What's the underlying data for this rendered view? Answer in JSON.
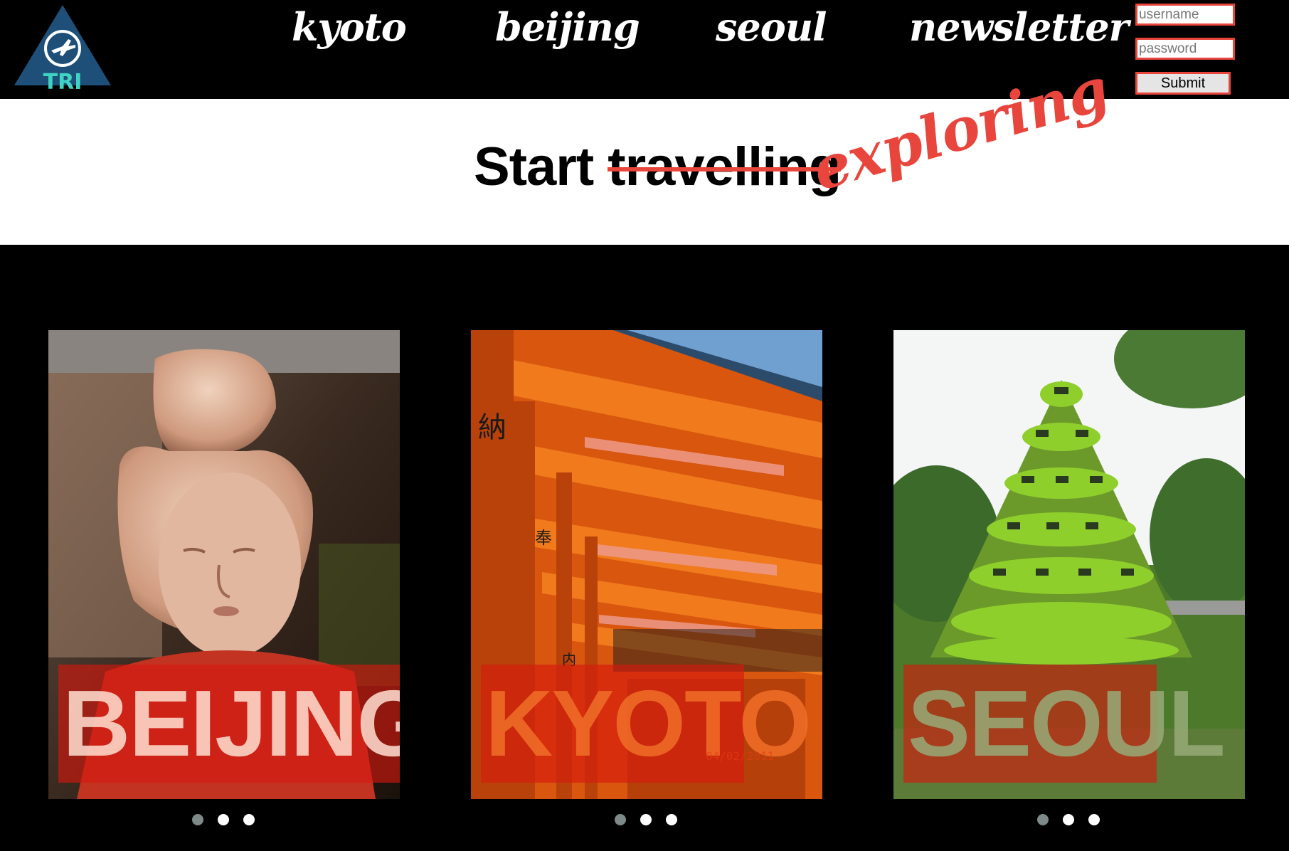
{
  "header": {
    "logo_text": "TRI",
    "nav": [
      {
        "label": "kyoto"
      },
      {
        "label": "beijing"
      },
      {
        "label": "seoul"
      },
      {
        "label": "newsletter"
      }
    ],
    "login": {
      "username_placeholder": "username",
      "password_placeholder": "password",
      "submit_label": "Submit"
    }
  },
  "hero": {
    "start": "Start ",
    "struck": "travelling",
    "accent": "exploring"
  },
  "cards": [
    {
      "city": "BEIJING",
      "dot_count": 3,
      "active_dot": 0
    },
    {
      "city": "KYOTO",
      "date_stamp": "04/02/2011",
      "dot_count": 3,
      "active_dot": 0
    },
    {
      "city": "SEOUL",
      "dot_count": 3,
      "active_dot": 0
    }
  ],
  "colors": {
    "accent": "#e8453c",
    "logo_triangle": "#1d4f78",
    "logo_text": "#3fd4c2",
    "dot_active": "#7d8a87",
    "dot_inactive": "#ffffff"
  },
  "icons": {
    "logo": "airplane-in-circle-icon"
  }
}
